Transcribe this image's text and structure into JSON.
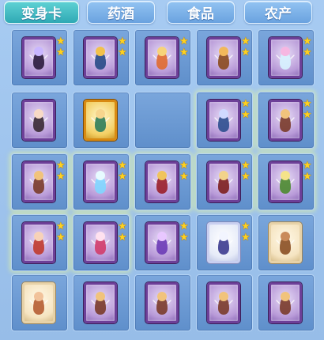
{
  "tabs": [
    {
      "label": "变身卡",
      "active": true
    },
    {
      "label": "药酒",
      "active": false
    },
    {
      "label": "食品",
      "active": false
    },
    {
      "label": "农产",
      "active": false
    }
  ],
  "colors": {
    "panel_bg": "#9ec3ec",
    "tab_active": "#2fa9b4",
    "tab_inactive": "#6aa2df",
    "slot_bg": "#6f9bd3",
    "card_frame_purple": "#6d3f98",
    "card_frame_gold": "#d88a12",
    "star": "#ffd21f"
  },
  "slots": [
    {
      "row": 0,
      "col": 0,
      "frame": "purple",
      "figure": "dark-warrior",
      "stars": 2,
      "glow": false
    },
    {
      "row": 0,
      "col": 1,
      "frame": "purple",
      "figure": "robot-pet",
      "stars": 2,
      "glow": false
    },
    {
      "row": 0,
      "col": 2,
      "frame": "purple",
      "figure": "fox-girl",
      "stars": 2,
      "glow": false
    },
    {
      "row": 0,
      "col": 3,
      "frame": "purple",
      "figure": "monkey-pet",
      "stars": 2,
      "glow": false
    },
    {
      "row": 0,
      "col": 4,
      "frame": "purple",
      "figure": "fairy",
      "stars": 2,
      "glow": false
    },
    {
      "row": 1,
      "col": 0,
      "frame": "purple",
      "figure": "ninja-girl",
      "stars": 0,
      "glow": false
    },
    {
      "row": 1,
      "col": 1,
      "frame": "gold",
      "figure": "warrior-girl",
      "stars": 0,
      "glow": false
    },
    {
      "row": 1,
      "col": 2,
      "frame": "empty",
      "figure": "",
      "stars": 0,
      "glow": false
    },
    {
      "row": 1,
      "col": 3,
      "frame": "purple",
      "figure": "blue-hero",
      "stars": 2,
      "glow": true
    },
    {
      "row": 1,
      "col": 4,
      "frame": "purple",
      "figure": "boar-demon",
      "stars": 2,
      "glow": true
    },
    {
      "row": 2,
      "col": 0,
      "frame": "purple",
      "figure": "boar-demon",
      "stars": 2,
      "glow": true
    },
    {
      "row": 2,
      "col": 1,
      "frame": "purple",
      "figure": "ice-dragon",
      "stars": 2,
      "glow": true
    },
    {
      "row": 2,
      "col": 2,
      "frame": "purple",
      "figure": "red-armor-hero",
      "stars": 2,
      "glow": true
    },
    {
      "row": 2,
      "col": 3,
      "frame": "purple",
      "figure": "armored-monk",
      "stars": 2,
      "glow": true
    },
    {
      "row": 2,
      "col": 4,
      "frame": "purple",
      "figure": "green-sage",
      "stars": 2,
      "glow": true
    },
    {
      "row": 3,
      "col": 0,
      "frame": "purple",
      "figure": "red-hair-girl",
      "stars": 2,
      "glow": true
    },
    {
      "row": 3,
      "col": 1,
      "frame": "purple",
      "figure": "fairy-girl",
      "stars": 2,
      "glow": true
    },
    {
      "row": 3,
      "col": 2,
      "frame": "purple",
      "figure": "purple-imp",
      "stars": 2,
      "glow": false
    },
    {
      "row": 3,
      "col": 3,
      "frame": "white",
      "figure": "sword-knight",
      "stars": 2,
      "glow": false
    },
    {
      "row": 3,
      "col": 4,
      "frame": "beige",
      "figure": "bear",
      "stars": 0,
      "glow": false
    },
    {
      "row": 4,
      "col": 0,
      "frame": "beige",
      "figure": "fat-monk",
      "stars": 0,
      "glow": false
    },
    {
      "row": 4,
      "col": 1,
      "frame": "purple",
      "figure": "boar-demon",
      "stars": 0,
      "glow": false
    },
    {
      "row": 4,
      "col": 2,
      "frame": "purple",
      "figure": "boar-demon",
      "stars": 0,
      "glow": false
    },
    {
      "row": 4,
      "col": 3,
      "frame": "purple",
      "figure": "boar-demon",
      "stars": 0,
      "glow": false
    },
    {
      "row": 4,
      "col": 4,
      "frame": "purple",
      "figure": "boar-demon",
      "stars": 0,
      "glow": false
    }
  ]
}
